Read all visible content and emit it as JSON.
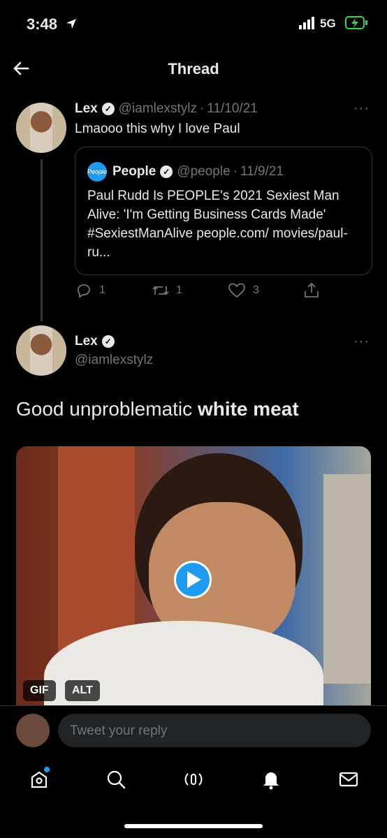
{
  "status": {
    "time": "3:48",
    "network": "5G"
  },
  "header": {
    "title": "Thread"
  },
  "tweet1": {
    "name": "Lex",
    "handle": "@iamlexstylz",
    "date": "11/10/21",
    "text": "Lmaooo this why I love Paul",
    "quote": {
      "logo_text": "People",
      "name": "People",
      "handle": "@people",
      "date": "11/9/21",
      "text": "Paul Rudd Is PEOPLE's 2021 Sexiest Man Alive: 'I'm Getting Business Cards Made' #SexiestManAlive people.com/ movies/paul-ru..."
    },
    "stats": {
      "replies": "1",
      "retweets": "1",
      "likes": "3"
    }
  },
  "tweet2": {
    "name": "Lex",
    "handle": "@iamlexstylz",
    "text_plain": "Good unproblematic ",
    "text_bold": "white meat",
    "media": {
      "gif_badge": "GIF",
      "alt_badge": "ALT"
    }
  },
  "reply": {
    "placeholder": "Tweet your reply"
  },
  "colors": {
    "accent": "#1d9bf0",
    "background": "#000000",
    "text": "#e7e9ea",
    "muted": "#71767b"
  }
}
